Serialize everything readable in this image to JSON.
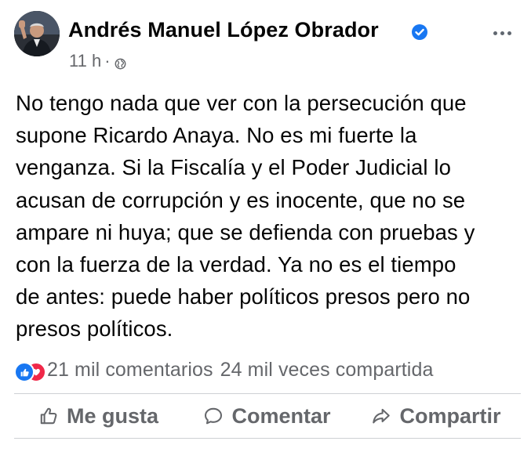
{
  "post": {
    "author": "Andrés Manuel López Obrador",
    "verified_icon": "verified-badge-icon",
    "timestamp": "11 h",
    "separator": "·",
    "audience_icon": "globe-icon",
    "more_icon": "more-options-icon",
    "text": "No tengo nada que ver con la persecución que\nsupone Ricardo Anaya. No es mi fuerte la\nvenganza. Si la Fiscalía y el Poder Judicial lo\nacusan de corrupción y es inocente, que no se\nampare ni huya; que se defienda con pruebas y\ncon la fuerza de la verdad. Ya no es el tiempo\nde antes: puede haber políticos presos pero no\npresos políticos."
  },
  "stats": {
    "reaction_icons": [
      "like-reaction-icon",
      "love-reaction-icon"
    ],
    "comments": "21 mil comentarios",
    "shares": "24 mil veces compartida"
  },
  "actions": {
    "like": "Me gusta",
    "comment": "Comentar",
    "share": "Compartir"
  },
  "colors": {
    "text": "#050505",
    "secondary": "#65676b",
    "brand_blue": "#1877f2",
    "love_red": "#f02849",
    "divider": "#ced0d4"
  }
}
